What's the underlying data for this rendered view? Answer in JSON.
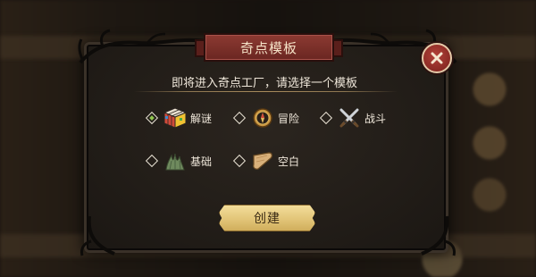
{
  "dialog": {
    "title": "奇点模板",
    "prompt": "即将进入奇点工厂，请选择一个模板",
    "close_glyph": "X",
    "create_label": "创建"
  },
  "options": [
    {
      "label": "解谜",
      "icon": "rubiks-cube-icon",
      "selected": true
    },
    {
      "label": "冒险",
      "icon": "compass-icon",
      "selected": false
    },
    {
      "label": "战斗",
      "icon": "crossed-swords-icon",
      "selected": false
    },
    {
      "label": "基础",
      "icon": "grass-bush-icon",
      "selected": false
    },
    {
      "label": "空白",
      "icon": "blank-scroll-icon",
      "selected": false
    }
  ],
  "colors": {
    "banner": "#7a2f28",
    "accent_selected": "#8fc44f",
    "button": "#e2c578",
    "close": "#9e342d"
  }
}
